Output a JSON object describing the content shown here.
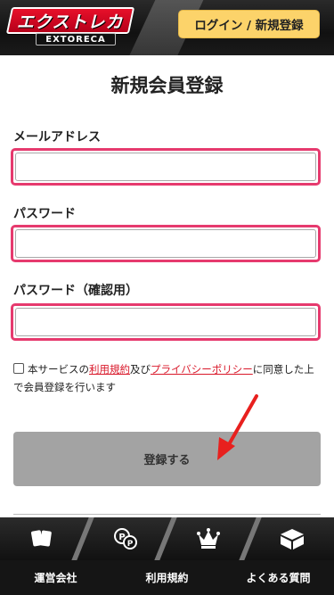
{
  "header": {
    "logo_text": "エクストレカ",
    "logo_sub": "EXTORECA",
    "login_label": "ログイン / 新規登録"
  },
  "page": {
    "title": "新規会員登録"
  },
  "form": {
    "email_label": "メールアドレス",
    "email_value": "",
    "password_label": "パスワード",
    "password_value": "",
    "password_confirm_label": "パスワード（確認用）",
    "password_confirm_value": "",
    "agree_prefix": "本サービスの",
    "terms_link": "利用規約",
    "agree_mid": "及び",
    "privacy_link": "プライバシーポリシー",
    "agree_suffix": "に同意した上で会員登録を行います",
    "agree_checked": false,
    "submit_label": "登録する"
  },
  "bottom_nav": {
    "icons": [
      "cards-icon",
      "points-icon",
      "crown-icon",
      "box-icon"
    ]
  },
  "footer": {
    "links": [
      "運営会社",
      "利用規約",
      "よくある質問"
    ]
  },
  "colors": {
    "header_bg": "#111111",
    "login_button": "#fcd36a",
    "field_highlight": "#e63a6e",
    "link_red": "#d9182a",
    "submit_bg": "#a3a3a3",
    "arrow_red": "#e8201e"
  }
}
